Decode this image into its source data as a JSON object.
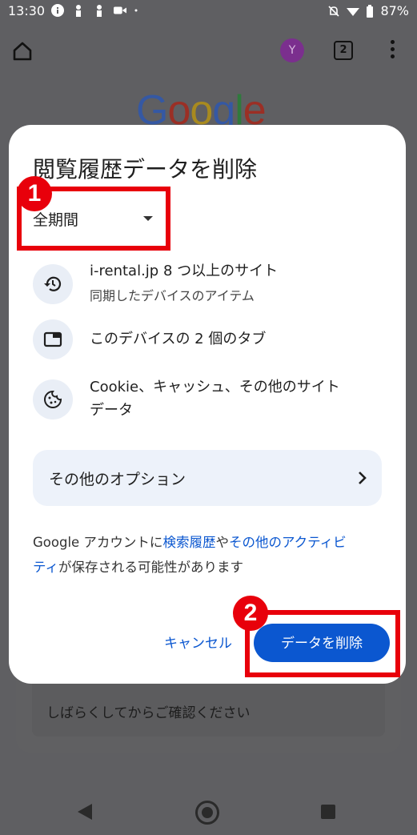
{
  "status_bar": {
    "time": "13:30",
    "battery": "87%"
  },
  "toolbar": {
    "avatar_letter": "Y",
    "tab_count": "2"
  },
  "background": {
    "logo": "Google",
    "card_text": "しばらくしてからご確認ください"
  },
  "dialog": {
    "title": "閲覧履歴データを削除",
    "time_range": "全期間",
    "rows": [
      {
        "icon": "history-icon",
        "label": "i-rental.jp 8 つ以上のサイト",
        "sublabel": "同期したデバイスのアイテム"
      },
      {
        "icon": "tab-icon",
        "label": "このデバイスの 2 個のタブ"
      },
      {
        "icon": "cookie-icon",
        "label_line1": "Cookie、キャッシュ、その他のサイト",
        "label_line2": "データ"
      }
    ],
    "more_options": "その他のオプション",
    "note": {
      "prefix": "Google アカウントに",
      "link1": "検索履歴",
      "middle": "や",
      "link2_line1": "その他のアクティビ",
      "link2_line2": "ティ",
      "suffix": "が保存される可能性があります"
    },
    "cancel_label": "キャンセル",
    "delete_label": "データを削除"
  },
  "annotations": {
    "badge1": "1",
    "badge2": "2",
    "color": "#e8000b"
  },
  "colors": {
    "accent": "#0b57d0",
    "scrim": "#5f5f62"
  }
}
